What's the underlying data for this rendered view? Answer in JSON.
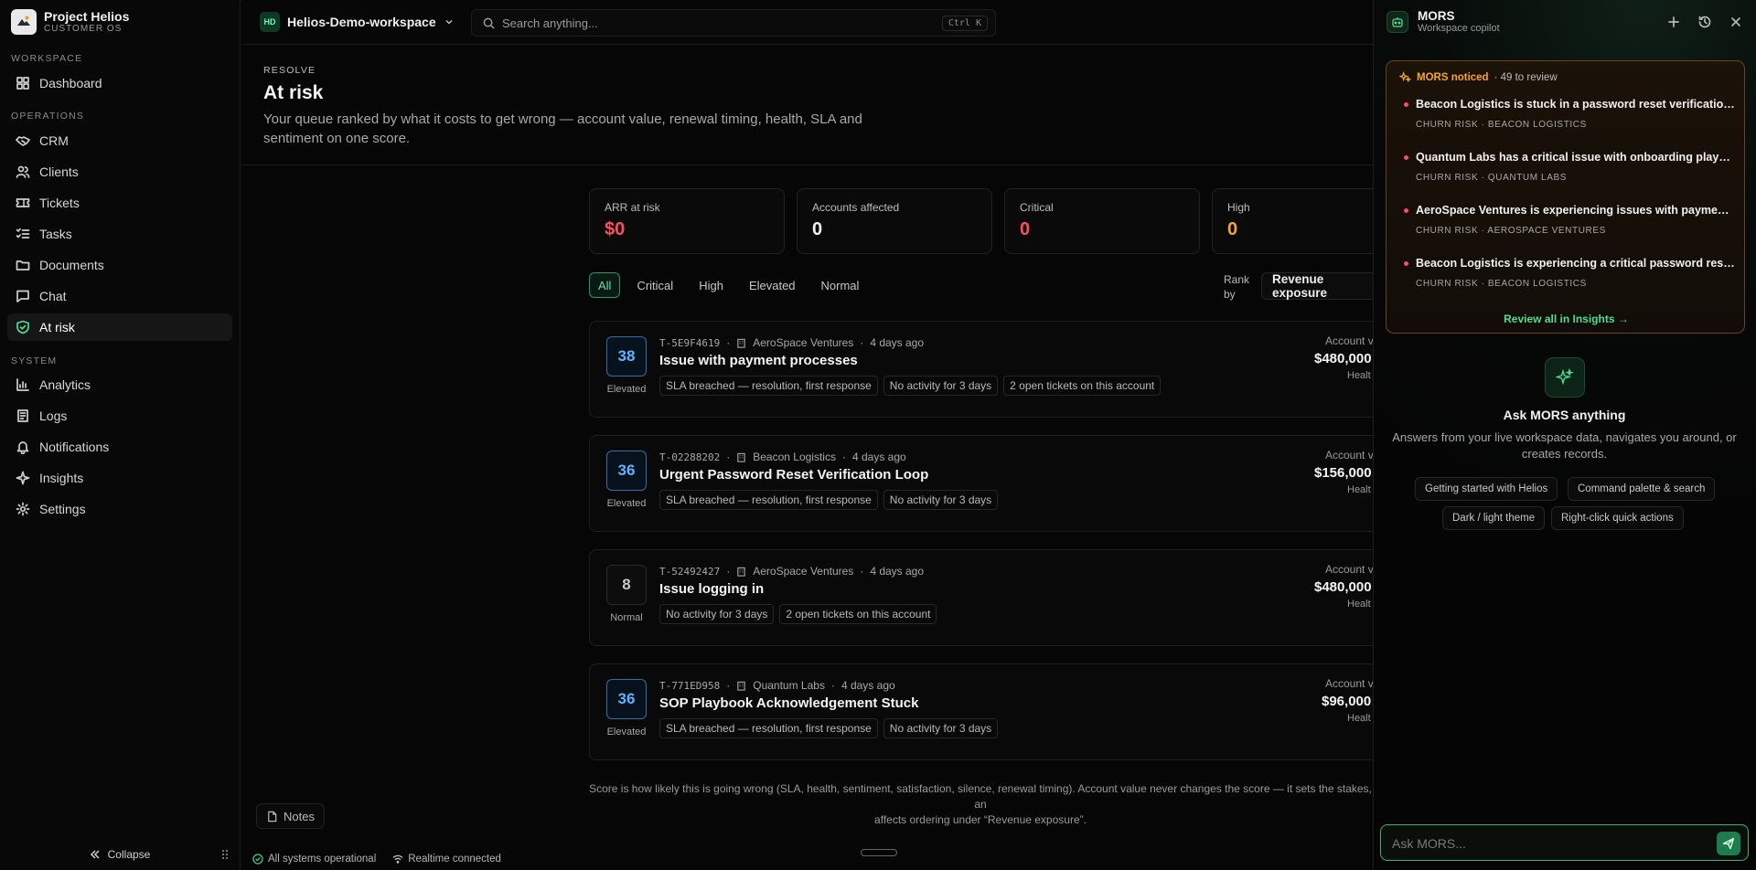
{
  "brand": {
    "name": "Project Helios",
    "sub": "CUSTOMER OS"
  },
  "nav": {
    "workspace_label": "WORKSPACE",
    "operations_label": "OPERATIONS",
    "system_label": "SYSTEM",
    "dashboard": "Dashboard",
    "crm": "CRM",
    "clients": "Clients",
    "tickets": "Tickets",
    "tasks": "Tasks",
    "documents": "Documents",
    "chat": "Chat",
    "at_risk": "At risk",
    "analytics": "Analytics",
    "logs": "Logs",
    "notifications": "Notifications",
    "insights": "Insights",
    "settings": "Settings",
    "collapse": "Collapse"
  },
  "topbar": {
    "workspace_badge": "HD",
    "workspace_name": "Helios-Demo-workspace",
    "search_placeholder": "Search anything...",
    "search_shortcut": "Ctrl K"
  },
  "header": {
    "eyebrow": "RESOLVE",
    "title": "At risk",
    "description": "Your queue ranked by what it costs to get wrong — account value, renewal timing, health, SLA and sentiment on one score."
  },
  "stats": [
    {
      "label": "ARR at risk",
      "value": "$0",
      "color": "#ff4d5e"
    },
    {
      "label": "Accounts affected",
      "value": "0",
      "color": "#f2f2f2"
    },
    {
      "label": "Critical",
      "value": "0",
      "color": "#ff4d5e"
    },
    {
      "label": "High",
      "value": "0",
      "color": "#f5a623"
    }
  ],
  "filters": {
    "all": "All",
    "critical": "Critical",
    "high": "High",
    "elevated": "Elevated",
    "normal": "Normal"
  },
  "rank": {
    "label_1": "Rank",
    "label_2": "by",
    "value": "Revenue exposure"
  },
  "tickets": [
    {
      "score": "38",
      "level": "Elevated",
      "id": "T-5E9F4619",
      "company": "AeroSpace Ventures",
      "age": "4 days ago",
      "title": "Issue with payment processes",
      "tags": [
        "SLA breached — resolution, first response",
        "No activity for 3 days",
        "2 open tickets on this account"
      ],
      "account_label": "Account v",
      "account_value": "$480,000",
      "health": "Healt"
    },
    {
      "score": "36",
      "level": "Elevated",
      "id": "T-02288202",
      "company": "Beacon Logistics",
      "age": "4 days ago",
      "title": "Urgent Password Reset Verification Loop",
      "tags": [
        "SLA breached — resolution, first response",
        "No activity for 3 days"
      ],
      "account_label": "Account v",
      "account_value": "$156,000",
      "health": "Healt"
    },
    {
      "score": "8",
      "level": "Normal",
      "id": "T-52492427",
      "company": "AeroSpace Ventures",
      "age": "4 days ago",
      "title": "Issue logging in",
      "tags": [
        "No activity for 3 days",
        "2 open tickets on this account"
      ],
      "account_label": "Account v",
      "account_value": "$480,000",
      "health": "Healt"
    },
    {
      "score": "36",
      "level": "Elevated",
      "id": "T-771ED958",
      "company": "Quantum Labs",
      "age": "4 days ago",
      "title": "SOP Playbook Acknowledgement Stuck",
      "tags": [
        "SLA breached — resolution, first response",
        "No activity for 3 days"
      ],
      "account_label": "Account v",
      "account_value": "$96,000",
      "health": "Healt"
    }
  ],
  "footnote": {
    "line_1": "Score is how likely this is going wrong (SLA, health, sentiment, satisfaction, silence, renewal timing). Account value never changes the score — it sets the stakes, an",
    "line_2": "affects ordering under “Revenue exposure”."
  },
  "notes_label": "Notes",
  "status": {
    "systems": "All systems operational",
    "realtime": "Realtime connected"
  },
  "copilot": {
    "title": "MORS",
    "subtitle": "Workspace copilot",
    "notice_title": "MORS noticed",
    "notice_count": "· 49 to review",
    "items": [
      {
        "title": "Beacon Logistics is stuck in a password reset verification l...",
        "sub": "CHURN RISK · BEACON LOGISTICS"
      },
      {
        "title": "Quantum Labs has a critical issue with onboarding playbo...",
        "sub": "CHURN RISK · QUANTUM LABS"
      },
      {
        "title": "AeroSpace Ventures is experiencing issues with payment ...",
        "sub": "CHURN RISK · AEROSPACE VENTURES"
      },
      {
        "title": "Beacon Logistics is experiencing a critical password reset ...",
        "sub": "CHURN RISK · BEACON LOGISTICS"
      }
    ],
    "review_link": "Review all in Insights →",
    "ask_title": "Ask MORS anything",
    "ask_desc": "Answers from your live workspace data, navigates you around, or creates records.",
    "suggestions": [
      "Getting started with Helios",
      "Command palette & search",
      "Dark / light theme",
      "Right-click quick actions"
    ],
    "input_placeholder": "Ask MORS..."
  },
  "colors": {
    "accent": "#2bb574",
    "elevated": "#5ab4ff",
    "danger": "#ff4d5e",
    "warning": "#f5a623"
  }
}
